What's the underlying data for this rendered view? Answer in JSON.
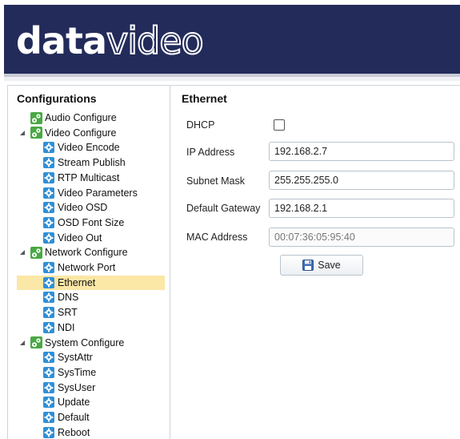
{
  "logo": {
    "part1": "data",
    "part2": "video"
  },
  "sidebar": {
    "title": "Configurations",
    "groups": [
      {
        "label": "Audio Configure",
        "icon": "gear-group-icon",
        "children": []
      },
      {
        "label": "Video Configure",
        "icon": "gear-group-icon",
        "children": [
          "Video Encode",
          "Stream Publish",
          "RTP Multicast",
          "Video Parameters",
          "Video OSD",
          "OSD Font Size",
          "Video Out"
        ]
      },
      {
        "label": "Network Configure",
        "icon": "gear-group-icon",
        "children": [
          "Network Port",
          "Ethernet",
          "DNS",
          "SRT",
          "NDI"
        ]
      },
      {
        "label": "System Configure",
        "icon": "gear-group-icon",
        "children": [
          "SystAttr",
          "SysTime",
          "SysUser",
          "Update",
          "Default",
          "Reboot"
        ]
      }
    ],
    "selected": "Ethernet"
  },
  "panel": {
    "title": "Ethernet",
    "dhcp_label": "DHCP",
    "dhcp_checked": false,
    "ip_label": "IP Address",
    "ip_value": "192.168.2.7",
    "subnet_label": "Subnet Mask",
    "subnet_value": "255.255.255.0",
    "gateway_label": "Default Gateway",
    "gateway_value": "192.168.2.1",
    "mac_label": "MAC Address",
    "mac_value": "00:07:36:05:95:40",
    "save_label": "Save"
  },
  "colors": {
    "header_bg": "#232b5a",
    "selected_bg": "#fbe7a6",
    "leaf_icon": "#2f8fd6",
    "group_icon": "#4aa844"
  }
}
